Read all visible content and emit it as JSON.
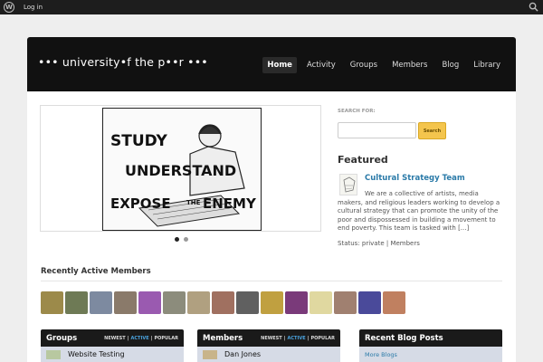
{
  "adminbar": {
    "login": "Log in"
  },
  "header": {
    "logo": "••• university•f the p••r •••",
    "nav": [
      "Home",
      "Activity",
      "Groups",
      "Members",
      "Blog",
      "Library"
    ]
  },
  "slider": {
    "lines": [
      "STUDY",
      "UNDERSTAND",
      "EXPOSE",
      "THE",
      "ENEMY"
    ]
  },
  "search": {
    "label": "SEARCH FOR:",
    "button": "Search",
    "placeholder": ""
  },
  "featured": {
    "heading": "Featured",
    "title": "Cultural Strategy Team",
    "text": "We are a collective of artists, media makers, and religious leaders working to develop a cultural strategy that can promote the unity of the poor and dispossessed in building a movement to end poverty. This team is tasked with [...]",
    "status": "Status: private | Members"
  },
  "members_section": {
    "title": "Recently Active Members",
    "avatar_colors": [
      "#9c8a4a",
      "#6e7a55",
      "#7d8aa0",
      "#8a7a6a",
      "#9a5ab0",
      "#8c8c7c",
      "#b0a080",
      "#a07060",
      "#606060",
      "#c0a040",
      "#7a3a7a",
      "#e0d8a0",
      "#a08070",
      "#4a4a9a",
      "#c08060"
    ]
  },
  "boxes": [
    {
      "title": "Groups",
      "filters": [
        "NEWEST",
        "|",
        "ACTIVE",
        "|",
        "POPULAR"
      ],
      "item": "Website Testing"
    },
    {
      "title": "Members",
      "filters": [
        "NEWEST",
        "|",
        "ACTIVE",
        "|",
        "POPULAR"
      ],
      "item": "Dan Jones"
    },
    {
      "title": "Recent Blog Posts",
      "filters": [],
      "item": "More Blogs"
    }
  ]
}
